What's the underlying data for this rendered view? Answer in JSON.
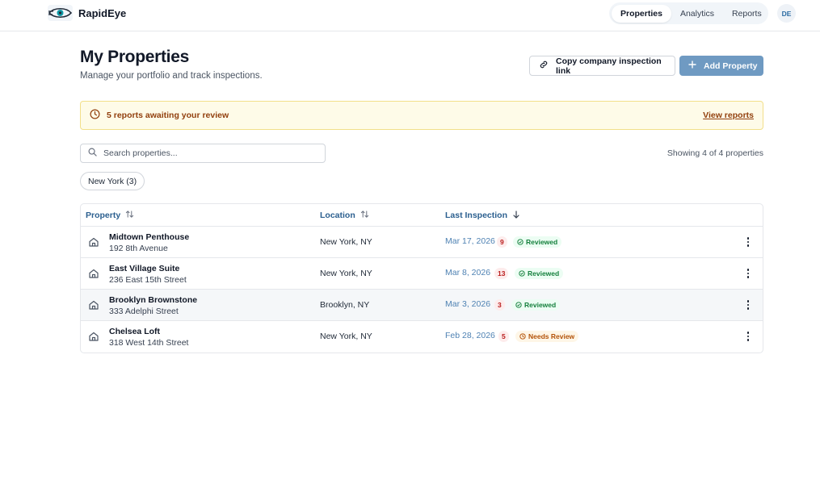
{
  "app": {
    "name": "RapidEye"
  },
  "nav": {
    "items": [
      {
        "label": "Properties",
        "active": true
      },
      {
        "label": "Analytics",
        "active": false
      },
      {
        "label": "Reports",
        "active": false
      }
    ],
    "user_initials": "DE"
  },
  "header": {
    "title": "My Properties",
    "subtitle": "Manage your portfolio and track inspections.",
    "copy_link_label": "Copy company inspection link",
    "add_property_label": "Add Property"
  },
  "alert": {
    "text": "5 reports awaiting your review",
    "link_label": "View reports"
  },
  "search": {
    "placeholder": "Search properties...",
    "value": ""
  },
  "showing_text": "Showing 4 of 4 properties",
  "filter_chip": "New York (3)",
  "table": {
    "columns": [
      {
        "label": "Property",
        "sort": "unsorted"
      },
      {
        "label": "Location",
        "sort": "unsorted"
      },
      {
        "label": "Last Inspection",
        "sort": "desc"
      }
    ],
    "rows": [
      {
        "name": "Midtown Penthouse",
        "address": "192 8th Avenue",
        "location": "New York, NY",
        "date": "Mar 17, 2026",
        "count": "9",
        "status": "Reviewed",
        "status_type": "ok"
      },
      {
        "name": "East Village Suite",
        "address": "236 East 15th Street",
        "location": "New York, NY",
        "date": "Mar 8, 2026",
        "count": "13",
        "status": "Reviewed",
        "status_type": "ok"
      },
      {
        "name": "Brooklyn Brownstone",
        "address": "333 Adelphi Street",
        "location": "Brooklyn, NY",
        "date": "Mar 3, 2026",
        "count": "3",
        "status": "Reviewed",
        "status_type": "ok"
      },
      {
        "name": "Chelsea Loft",
        "address": "318 West 14th Street",
        "location": "New York, NY",
        "date": "Feb 28, 2026",
        "count": "5",
        "status": "Needs Review",
        "status_type": "warn"
      }
    ]
  },
  "colors": {
    "accent": "#6f9ac2",
    "alert_bg": "#fefbe8",
    "alert_text": "#92400e",
    "reviewed": "#15803d",
    "needs_review": "#b45309",
    "count_badge": "#b91c1c"
  },
  "icons": {
    "logo": "eye-logo-icon",
    "copy": "link-icon",
    "add": "plus-icon",
    "alert": "clock-icon",
    "search": "search-icon",
    "sort": "sort-icon",
    "row": "home-icon",
    "status_ok": "check-circle-icon",
    "status_warn": "clock-icon",
    "menu": "more-vertical-icon"
  }
}
